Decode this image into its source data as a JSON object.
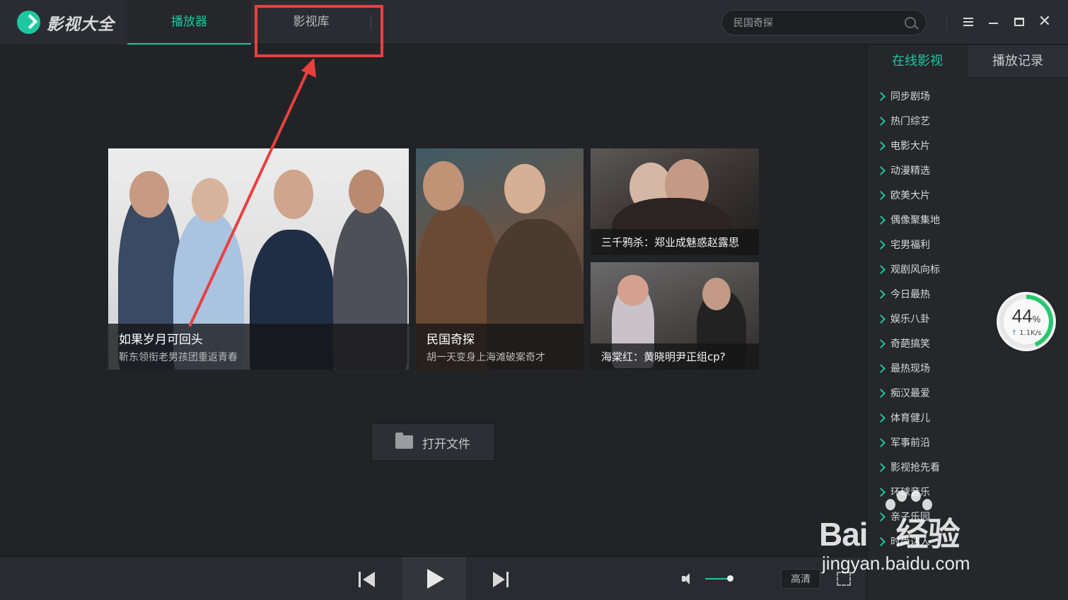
{
  "app": {
    "name": "影视大全"
  },
  "tabs": [
    {
      "label": "播放器",
      "active": true
    },
    {
      "label": "影视库",
      "active": false
    }
  ],
  "search": {
    "value": "民国奇探"
  },
  "sidebar": {
    "tabs": [
      {
        "label": "在线影视",
        "active": true
      },
      {
        "label": "播放记录",
        "active": false
      }
    ],
    "categories": [
      "同步剧场",
      "热门综艺",
      "电影大片",
      "动漫精选",
      "欧美大片",
      "偶像聚集地",
      "宅男福利",
      "观剧风向标",
      "今日最热",
      "娱乐八卦",
      "奇葩搞笑",
      "最热现场",
      "痴汉最爱",
      "体育健儿",
      "军事前沿",
      "影视抢先看",
      "环球音乐",
      "亲子乐园",
      "时尚达人"
    ]
  },
  "posters": [
    {
      "title": "如果岁月可回头",
      "subtitle": "靳东领衔老男孩团重返青春"
    },
    {
      "title": "民国奇探",
      "subtitle": "胡一天变身上海滩破案奇才"
    },
    {
      "title": "三千鸦杀：郑业成魅惑赵露思"
    },
    {
      "title": "海棠红：黄晓明尹正组cp?"
    }
  ],
  "open_file": {
    "label": "打开文件"
  },
  "player": {
    "quality": "高清",
    "volume_level": 0.85
  },
  "network": {
    "percent": "44",
    "percent_unit": "%",
    "speed": "1.1K/s",
    "progress": 0.44
  },
  "watermark": {
    "brand": "Bai",
    "brand_suffix": "经验",
    "url": "jingyan.baidu.com"
  },
  "colors": {
    "accent": "#1fc6a0",
    "annotation": "#e8403f"
  },
  "icons": {
    "logo": "play-logo-icon",
    "search": "search-icon",
    "menu": "menu-icon",
    "minimize": "minimize-icon",
    "maximize": "maximize-icon",
    "close": "close-icon",
    "folder": "folder-icon",
    "prev": "skip-previous-icon",
    "play": "play-icon",
    "next": "skip-next-icon",
    "volume": "volume-icon",
    "fullscreen": "fullscreen-icon"
  }
}
